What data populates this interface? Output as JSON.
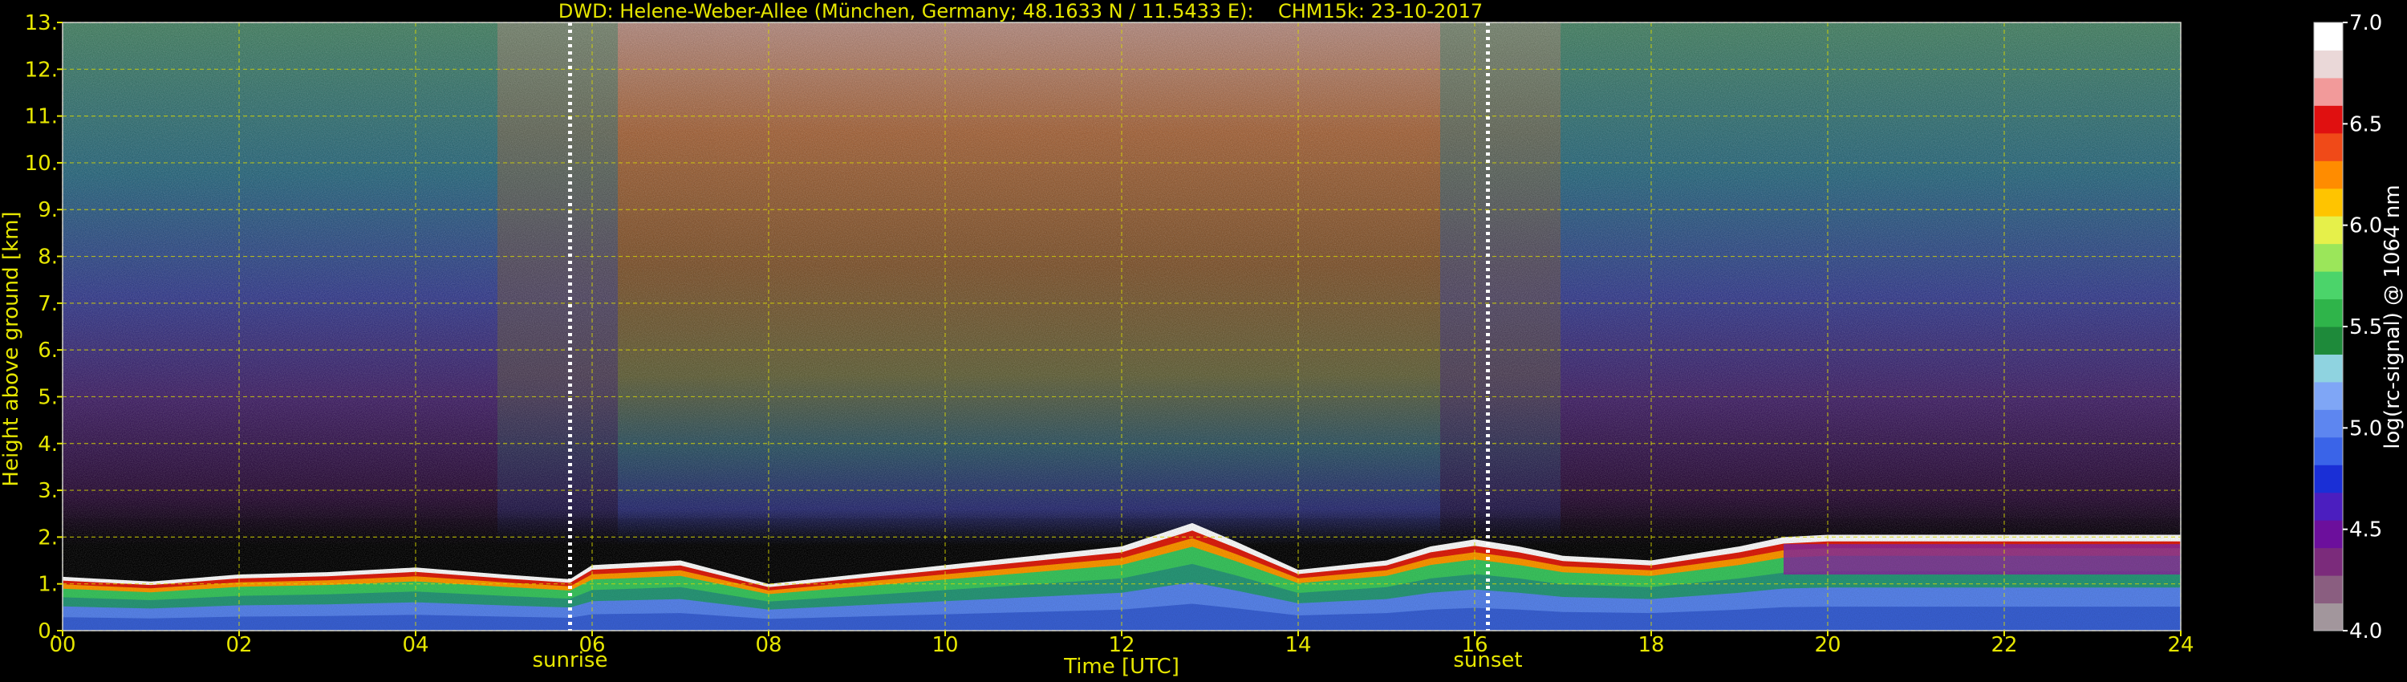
{
  "chart_data": {
    "type": "heatmap",
    "title": "DWD: Helene-Weber-Allee (München, Germany; 48.1633 N / 11.5433 E):    CHM15k: 23-10-2017",
    "xlabel": "Time [UTC]",
    "ylabel": "Height above ground [km]",
    "colorbar_label": "log(rc-signal) @ 1064 nm",
    "xlim": [
      0,
      24
    ],
    "ylim": [
      0,
      13
    ],
    "clim": [
      4.0,
      7.0
    ],
    "x_ticks": [
      0,
      2,
      4,
      6,
      8,
      10,
      12,
      14,
      16,
      18,
      20,
      22,
      24
    ],
    "x_tick_labels": [
      "00",
      "02",
      "04",
      "06",
      "08",
      "10",
      "12",
      "14",
      "16",
      "18",
      "20",
      "22",
      "24"
    ],
    "y_ticks": [
      0,
      1,
      2,
      3,
      4,
      5,
      6,
      7,
      8,
      9,
      10,
      11,
      12,
      13
    ],
    "y_tick_labels": [
      "0.",
      "1.",
      "2.",
      "3.",
      "4.",
      "5.",
      "6.",
      "7.",
      "8.",
      "9.",
      "10.",
      "11.",
      "12.",
      "13."
    ],
    "colorbar_ticks": [
      4.0,
      4.5,
      5.0,
      5.5,
      6.0,
      6.5,
      7.0
    ],
    "colorbar_tick_labels": [
      "4.0",
      "4.5",
      "5.0",
      "5.5",
      "6.0",
      "6.5",
      "7.0"
    ],
    "colormap": [
      "#a2969c",
      "#8a5e80",
      "#7b2b7b",
      "#6c0f9c",
      "#4b1ebf",
      "#1a2fd6",
      "#3a64e8",
      "#5d86f0",
      "#7fa6f6",
      "#8fd3e0",
      "#1e8a3a",
      "#2fb44a",
      "#4bd46a",
      "#9be65a",
      "#e6f04a",
      "#ffc400",
      "#ff8c00",
      "#f04a18",
      "#e01010",
      "#f29a9a",
      "#ead8d8",
      "#ffffff"
    ],
    "markers": [
      {
        "label": "sunrise",
        "x": 5.75
      },
      {
        "label": "sunset",
        "x": 16.15
      }
    ],
    "grid": true,
    "grid_color": "#d8d800",
    "text_color": "#e6e600",
    "boundary_layer_top_km": [
      [
        0,
        1.15
      ],
      [
        1,
        1.05
      ],
      [
        2,
        1.2
      ],
      [
        3,
        1.25
      ],
      [
        4,
        1.35
      ],
      [
        5,
        1.2
      ],
      [
        5.75,
        1.1
      ],
      [
        6,
        1.4
      ],
      [
        7,
        1.5
      ],
      [
        8,
        1.0
      ],
      [
        9,
        1.2
      ],
      [
        10,
        1.4
      ],
      [
        11,
        1.6
      ],
      [
        12,
        1.8
      ],
      [
        12.8,
        2.3
      ],
      [
        13.3,
        1.9
      ],
      [
        14,
        1.3
      ],
      [
        15,
        1.5
      ],
      [
        15.5,
        1.8
      ],
      [
        16,
        1.95
      ],
      [
        16.5,
        1.8
      ],
      [
        17,
        1.6
      ],
      [
        18,
        1.5
      ],
      [
        19,
        1.8
      ],
      [
        19.5,
        2.0
      ],
      [
        20,
        2.05
      ],
      [
        21,
        2.05
      ],
      [
        22,
        2.05
      ],
      [
        23,
        2.05
      ],
      [
        24,
        2.05
      ]
    ]
  }
}
